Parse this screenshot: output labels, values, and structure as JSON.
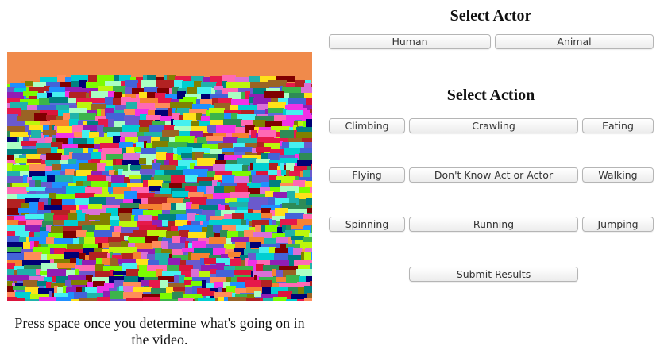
{
  "caption": "Press space once you determine what's going on in the video.",
  "actor": {
    "heading": "Select Actor",
    "buttons": [
      "Human",
      "Animal"
    ]
  },
  "action": {
    "heading": "Select Action",
    "rows": [
      [
        "Climbing",
        "Crawling",
        "Eating"
      ],
      [
        "Flying",
        "Don't Know Act or Actor",
        "Walking"
      ],
      [
        "Spinning",
        "Running",
        "Jumping"
      ]
    ]
  },
  "submit_label": "Submit Results"
}
